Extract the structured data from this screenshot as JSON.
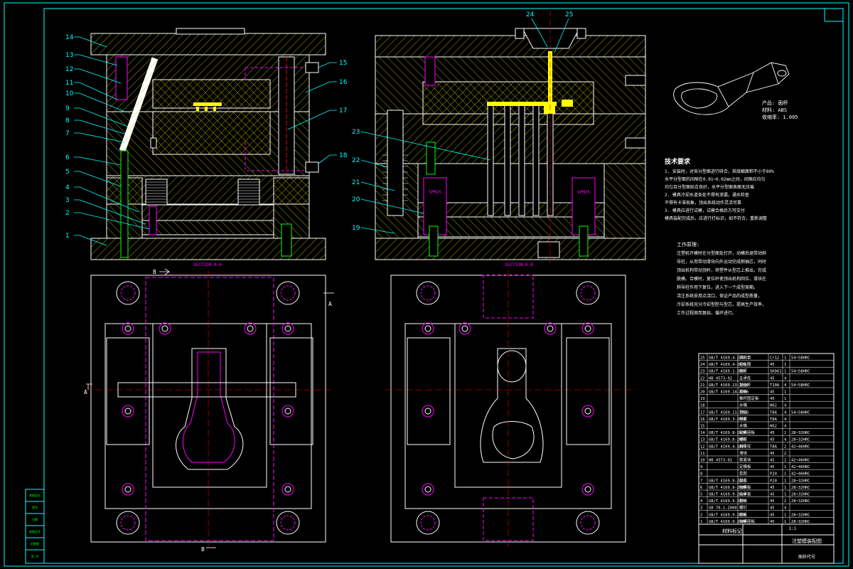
{
  "part_numbers_left": [
    "14",
    "13",
    "12",
    "11",
    "10",
    "9",
    "8",
    "7",
    "6",
    "5",
    "4",
    "3",
    "2",
    "1"
  ],
  "part_numbers_right_a": [
    "15",
    "16",
    "17",
    "18"
  ],
  "part_numbers_right_b": [
    "23",
    "22",
    "21",
    "20",
    "19"
  ],
  "top_callouts": [
    "24",
    "25"
  ],
  "section_labels": {
    "aa": "SECTION A-A",
    "bb": "SECTION B-B"
  },
  "cut_markers": {
    "a": "A",
    "b": "B"
  },
  "spring_tags": [
    "SPM25",
    "SPM25"
  ],
  "product_info": [
    "产品: 面杯",
    "材料: ABS",
    "收缩率: 1.005"
  ],
  "tech_title": "技术要求",
  "tech_lines": [
    "1. 安装时，对各分型面进行研合，其接触面积不小于80%",
    "水平分型面的间隙在0.01~0.02mm之间，间隙应均匀",
    "均匀且分型面贴合良好，水平分型面表面无压痕",
    "2. 模具冷却水道各处不得有渗漏，通水检查",
    "不得有卡滞现象，顶出系统动作灵活可靠",
    "3. 模具应进行试模，试模合格后方可交付",
    "模具装配完成后，应进行打标识，如不符合，重新调整"
  ],
  "process_title": "工作原理:",
  "process_lines": [
    "注塑机开模时在分型面处打开，动模后退带动斜",
    "导柱，从而带动滑块向外运动完成侧抽芯，同时",
    "顶出机构带动顶杆，将塑件从型芯上推出，完成",
    "脱模。合模时，复位杆使顶出机构回位，滑块在",
    "斜导柱作用下复位，进入下一个成型周期。",
    "浇注系统采用点浇口，保证产品的成型质量，",
    "冷却系统充分冷却型腔与型芯，提高生产效率，",
    "工作过程周而复始，循环进行。"
  ],
  "bom": [
    [
      "25",
      "GB/T 4169.4-2006",
      "浇口套",
      "Cr12",
      "1",
      "54~58HRC"
    ],
    [
      "24",
      "GB/T 4169.4-2006",
      "定位圈",
      "45",
      "1",
      ""
    ],
    [
      "23",
      "GB/T 4169.1-2006",
      "推杆",
      "SKD61",
      "1",
      "54~58HRC"
    ],
    [
      "22",
      "HB 4573-92",
      "支承柱",
      "45",
      "4",
      ""
    ],
    [
      "21",
      "GB/T 4169.13-2006",
      "复位杆",
      "T10A",
      "4",
      "54~58HRC"
    ],
    [
      "20",
      "GB/T 4169.14-2006",
      "推板",
      "45",
      "1",
      ""
    ],
    [
      "19",
      "",
      "推杆固定板",
      "45",
      "1",
      ""
    ],
    [
      "18",
      "",
      "水嘴",
      "H62",
      "4",
      ""
    ],
    [
      "17",
      "GB/T 4169.11-2006",
      "导柱",
      "T8A",
      "4",
      "54~58HRC"
    ],
    [
      "16",
      "GB/T 4169.3-2006",
      "导套",
      "T8A",
      "4",
      ""
    ],
    [
      "15",
      "",
      "水嘴",
      "H62",
      "4",
      ""
    ],
    [
      "14",
      "GB/T 4169.8-2006",
      "定模座板",
      "45",
      "1",
      "28~32HRC"
    ],
    [
      "13",
      "GB/T 4169.8-2006",
      "螺钉",
      "45",
      "4",
      "28~32HRC"
    ],
    [
      "12",
      "GB/T 4169.4-1984",
      "斜导柱",
      "T8A",
      "2",
      "42~46HRC"
    ],
    [
      "11",
      "",
      "滑块",
      "45",
      "2",
      ""
    ],
    [
      "10",
      "HB 4573-92",
      "楔紧块",
      "45",
      "2",
      "42~46HRC"
    ],
    [
      "9",
      "",
      "定模板",
      "45",
      "1",
      "42~46HRC"
    ],
    [
      "8",
      "",
      "型腔",
      "P20",
      "1",
      "42~46HRC"
    ],
    [
      "7",
      "GB/T 4169.9-2006",
      "型芯",
      "P20",
      "1",
      "28~32HRC"
    ],
    [
      "6",
      "GB/T 4169.9-2006",
      "动模板",
      "45",
      "1",
      "28~32HRC"
    ],
    [
      "5",
      "GB/T 4169.9-2006",
      "支承板",
      "45",
      "1",
      "28~32HRC"
    ],
    [
      "4",
      "GB/T 4169.9-2006",
      "垫块",
      "45",
      "2",
      "28~32HRC"
    ],
    [
      "3",
      "GB 70.1-2000",
      "螺钉",
      "45",
      "4",
      ""
    ],
    [
      "2",
      "GB/T 4169.9-2006",
      "推板",
      "45",
      "1",
      "28~32HRC"
    ],
    [
      "1",
      "GB/T 4169.9-2006",
      "动模座板",
      "45",
      "1",
      "28~32HRC"
    ]
  ],
  "title_block": {
    "material_mark": "材料标记",
    "scale": "1:1",
    "drawing_name": "注塑模装配图",
    "drawing_code": "图样代号"
  },
  "left_strip_labels": [
    "底图总号",
    "签字",
    "日期",
    "底图总号",
    "旧底图",
    "签 字"
  ],
  "colors": {
    "yellow": "#ffff00",
    "cyan": "#00ffff",
    "magenta": "#ff00ff",
    "white": "#ffffff",
    "green": "#00ff00",
    "red": "#ff0000",
    "blue": "#0000ff"
  }
}
